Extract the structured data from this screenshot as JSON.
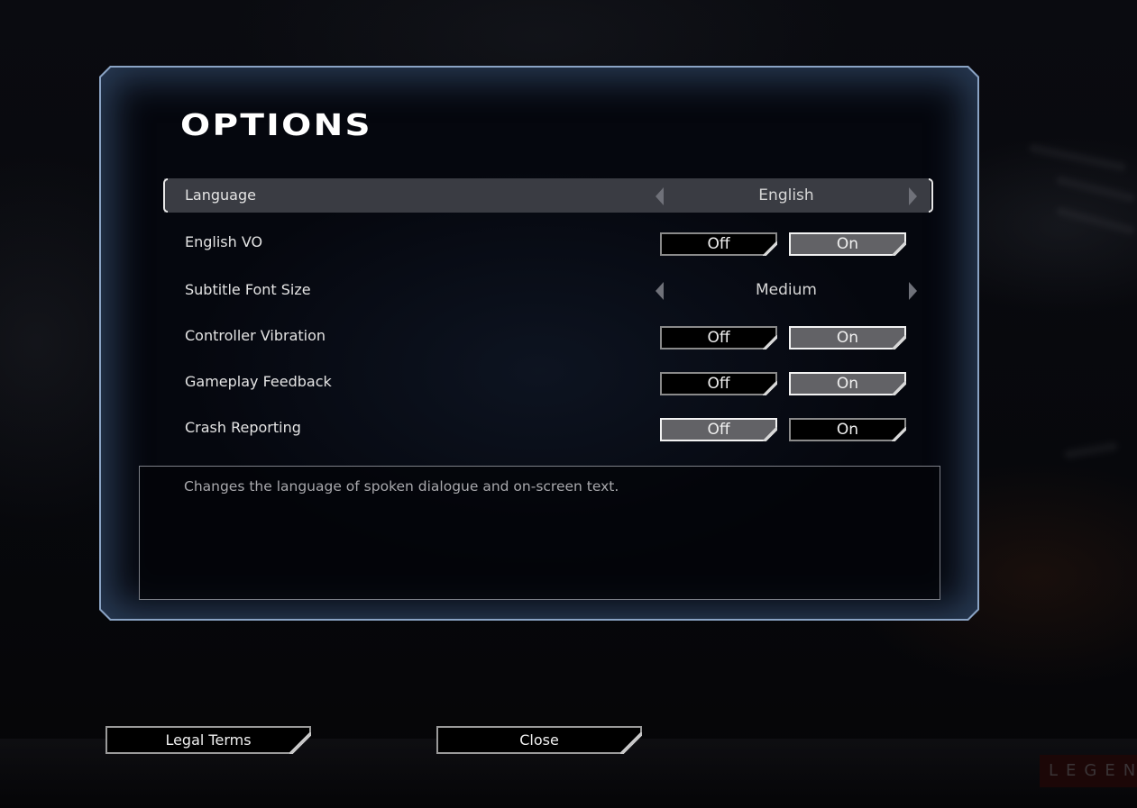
{
  "title": "OPTIONS",
  "settings": [
    {
      "label": "Language",
      "type": "spinner",
      "value": "English",
      "selected": true
    },
    {
      "label": "English VO",
      "type": "toggle",
      "options": [
        "Off",
        "On"
      ],
      "active": "On"
    },
    {
      "label": "Subtitle Font Size",
      "type": "spinner",
      "value": "Medium",
      "selected": false
    },
    {
      "label": "Controller Vibration",
      "type": "toggle",
      "options": [
        "Off",
        "On"
      ],
      "active": "On"
    },
    {
      "label": "Gameplay Feedback",
      "type": "toggle",
      "options": [
        "Off",
        "On"
      ],
      "active": "On"
    },
    {
      "label": "Crash Reporting",
      "type": "toggle",
      "options": [
        "Off",
        "On"
      ],
      "active": "Off"
    }
  ],
  "description": "Changes the language of spoken dialogue and on-screen text.",
  "buttons": {
    "legal_terms": "Legal Terms",
    "close": "Close"
  },
  "brand_text": "LEGENDA",
  "colors": {
    "panel_border": "#8aa3c4",
    "active_toggle_fill": "#626266",
    "selected_row": "#3a3c43"
  }
}
